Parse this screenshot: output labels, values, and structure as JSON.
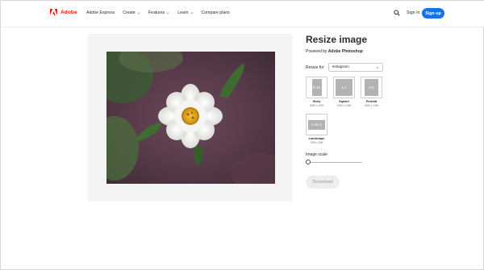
{
  "header": {
    "brand": "Adobe",
    "nav": [
      {
        "label": "Adobe Express",
        "has_menu": false
      },
      {
        "label": "Create",
        "has_menu": true
      },
      {
        "label": "Features",
        "has_menu": true
      },
      {
        "label": "Learn",
        "has_menu": true
      },
      {
        "label": "Compare plans",
        "has_menu": false
      }
    ],
    "sign_in": "Sign In",
    "sign_up": "Sign up",
    "brand_color": "#e61a00",
    "accent_color": "#1473e6"
  },
  "panel": {
    "title": "Resize image",
    "powered_prefix": "Powered by",
    "powered_brand": "Adobe Photoshop",
    "resize_for_label": "Resize for",
    "resize_for_value": "Instagram",
    "presets": [
      {
        "ratio": "9:16",
        "name": "Story",
        "dims": "1080 x 1920"
      },
      {
        "ratio": "1:1",
        "name": "Square",
        "dims": "1080 x 1080"
      },
      {
        "ratio": "4:5",
        "name": "Portrait",
        "dims": "1080 x 1350"
      },
      {
        "ratio": "1.91:1",
        "name": "Landscape",
        "dims": "1080 x 566"
      }
    ],
    "image_scale_label": "Image scale",
    "image_scale_value": 0,
    "download_label": "Download"
  },
  "image": {
    "subject": "white-flower-photo"
  }
}
